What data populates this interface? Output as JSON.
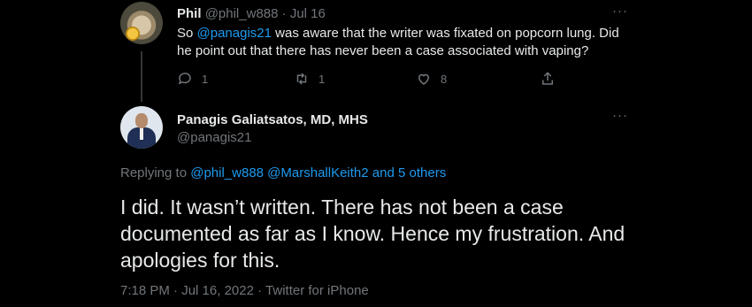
{
  "reply_tweet": {
    "author_name": "Phil",
    "handle": "@phil_w888",
    "separator": "·",
    "date": "Jul 16",
    "text_parts": {
      "before": "So ",
      "mention": "@panagis21",
      "after": " was aware that the writer was fixated on popcorn lung. Did he point out that there has never been a case associated with vaping?"
    },
    "counts": {
      "replies": "1",
      "retweets": "1",
      "likes": "8"
    },
    "more_label": "···"
  },
  "main_tweet": {
    "author_name": "Panagis Galiatsatos, MD, MHS",
    "handle": "@panagis21",
    "more_label": "···",
    "replying": {
      "prefix": "Replying to ",
      "mention_1": "@phil_w888",
      "mention_2": "@MarshallKeith2",
      "others": "and 5 others"
    },
    "text": "I did. It wasn’t written. There has not been a case documented as far as I know. Hence my frustration. And apologies for this.",
    "time": "7:18 PM",
    "date": "Jul 16, 2022",
    "source": "Twitter for iPhone",
    "separator": "·"
  },
  "colors": {
    "background": "#000000",
    "text": "#e7e9ea",
    "muted": "#71767b",
    "link": "#1d9bf0"
  },
  "icons": [
    "reply-icon",
    "retweet-icon",
    "like-icon",
    "share-icon",
    "more-icon"
  ]
}
